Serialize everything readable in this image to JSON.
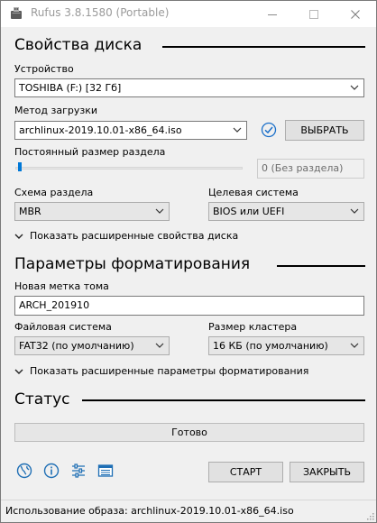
{
  "window": {
    "title": "Rufus 3.8.1580 (Portable)"
  },
  "disk": {
    "heading": "Свойства диска",
    "device_label": "Устройство",
    "device_value": "TOSHIBA (F:) [32 Гб]",
    "boot_label": "Метод загрузки",
    "boot_value": "archlinux-2019.10.01-x86_64.iso",
    "select_button": "ВЫБРАТЬ",
    "persistent_label": "Постоянный размер раздела",
    "persistent_value": "0 (Без раздела)",
    "persistent_slider_fraction": 0,
    "partition_label": "Схема раздела",
    "partition_value": "MBR",
    "target_label": "Целевая система",
    "target_value": "BIOS или UEFI",
    "advanced_toggle": "Показать расширенные свойства диска"
  },
  "format": {
    "heading": "Параметры форматирования",
    "volume_label": "Новая метка тома",
    "volume_value": "ARCH_201910",
    "fs_label": "Файловая система",
    "fs_value": "FAT32 (по умолчанию)",
    "cluster_label": "Размер кластера",
    "cluster_value": "16 КБ (по умолчанию)",
    "advanced_toggle": "Показать расширенные параметры форматирования"
  },
  "status": {
    "heading": "Статус",
    "progress_text": "Готово",
    "progress_fraction": 0
  },
  "actions": {
    "start": "СТАРТ",
    "close": "ЗАКРЫТЬ"
  },
  "footer": {
    "text": "Использование образа: archlinux-2019.10.01-x86_64.iso"
  },
  "colors": {
    "accent": "#0078d7",
    "check_icon": "#1a6fc9",
    "toolbar_icon": "#1f6fb5"
  }
}
